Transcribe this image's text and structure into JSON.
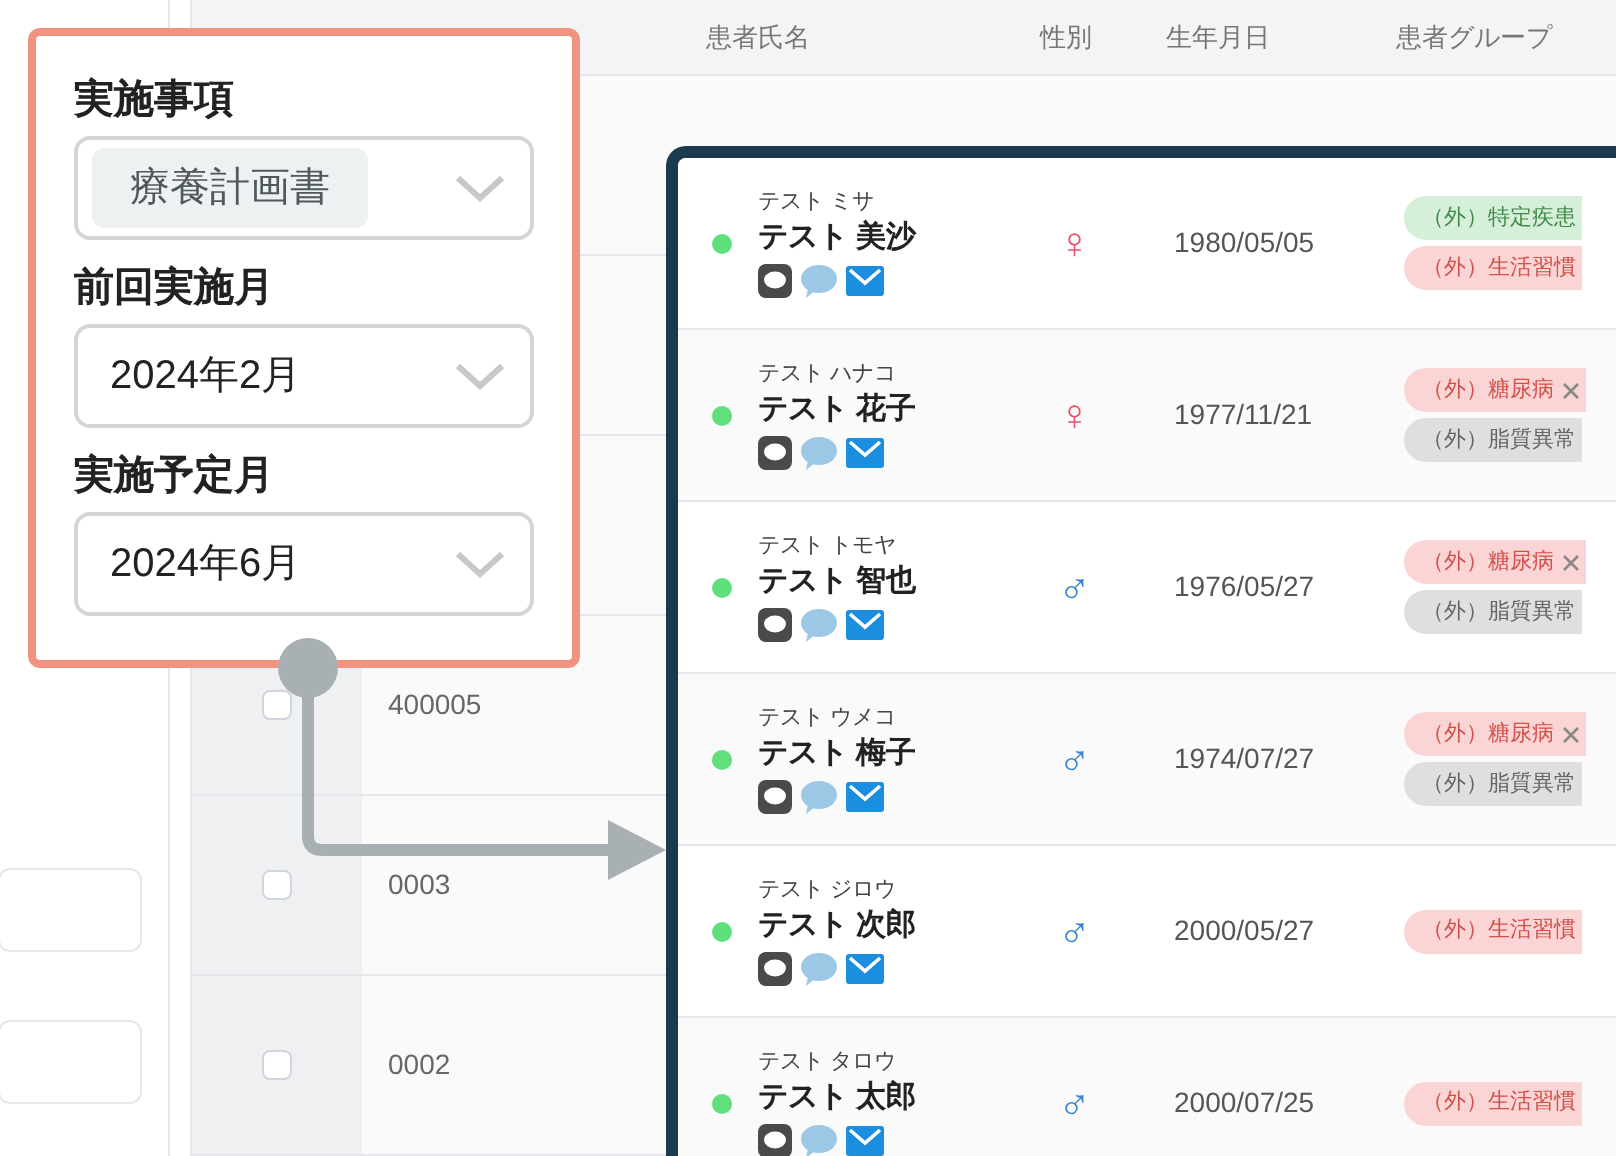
{
  "sidebar": {
    "fields": [
      {
        "kind": "input"
      },
      {
        "kind": "input"
      }
    ]
  },
  "filter_popup": {
    "fields": [
      {
        "label": "実施事項",
        "kind": "chip",
        "value": "療養計画書"
      },
      {
        "label": "前回実施月",
        "kind": "text",
        "value": "2024年2月"
      },
      {
        "label": "実施予定月",
        "kind": "text",
        "value": "2024年6月"
      }
    ]
  },
  "background_table": {
    "rows": [
      {
        "id": "400005",
        "checked": false
      },
      {
        "id": "0003",
        "checked": false
      },
      {
        "id": "0002",
        "checked": false
      }
    ]
  },
  "patient_table": {
    "columns": [
      "患者氏名",
      "性別",
      "生年月日",
      "患者グループ"
    ],
    "rows": [
      {
        "kana": "テスト ミサ",
        "name": "テスト 美沙",
        "active": true,
        "gender": "♀",
        "kind": "female",
        "birthdate": "1980/05/05",
        "groups": [
          {
            "label": "（外）特定疾患",
            "color": "#d6efd8",
            "removable": false
          },
          {
            "label": "（外）生活習慣",
            "color": "#fbd5d5",
            "removable": false
          }
        ]
      },
      {
        "kana": "テスト ハナコ",
        "name": "テスト 花子",
        "active": true,
        "gender": "♀",
        "kind": "female",
        "birthdate": "1977/11/21",
        "groups": [
          {
            "label": "（外）糖尿病",
            "color": "#fbd5d5",
            "removable": true
          },
          {
            "label": "（外）脂質異常",
            "color": "#dedfe0",
            "removable": false
          }
        ]
      },
      {
        "kana": "テスト トモヤ",
        "name": "テスト 智也",
        "active": true,
        "gender": "♂",
        "kind": "male",
        "birthdate": "1976/05/27",
        "groups": [
          {
            "label": "（外）糖尿病",
            "color": "#fbd5d5",
            "removable": true
          },
          {
            "label": "（外）脂質異常",
            "color": "#dedfe0",
            "removable": false
          }
        ]
      },
      {
        "kana": "テスト ウメコ",
        "name": "テスト 梅子",
        "active": true,
        "gender": "♂",
        "kind": "male",
        "birthdate": "1974/07/27",
        "groups": [
          {
            "label": "（外）糖尿病",
            "color": "#fbd5d5",
            "removable": true
          },
          {
            "label": "（外）脂質異常",
            "color": "#dedfe0",
            "removable": false
          }
        ]
      },
      {
        "kana": "テスト ジロウ",
        "name": "テスト 次郎",
        "active": true,
        "gender": "♂",
        "kind": "male",
        "birthdate": "2000/05/27",
        "groups": [
          {
            "label": "（外）生活習慣",
            "color": "#fbd5d5",
            "removable": false
          }
        ]
      },
      {
        "kana": "テスト タロウ",
        "name": "テスト 太郎",
        "active": true,
        "gender": "♂",
        "kind": "male",
        "birthdate": "2000/07/25",
        "groups": [
          {
            "label": "（外）生活習慣",
            "color": "#fbd5d5",
            "removable": false
          }
        ]
      }
    ]
  }
}
